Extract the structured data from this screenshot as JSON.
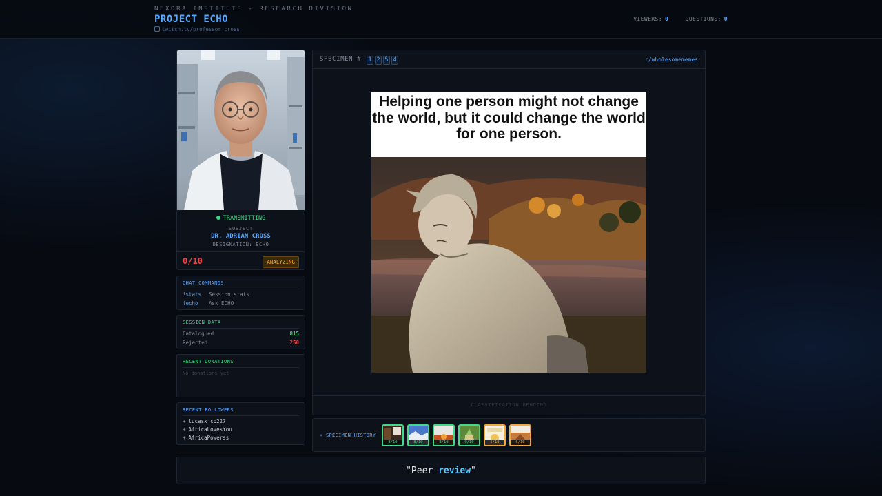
{
  "header": {
    "org": "NEXORA INSTITUTE - RESEARCH DIVISION",
    "project": "PROJECT ECHO",
    "channel": "twitch.tv/professor_cross",
    "viewers_label": "VIEWERS:",
    "viewers_value": "0",
    "questions_label": "QUESTIONS:",
    "questions_value": "0"
  },
  "subject": {
    "status": "TRANSMITTING",
    "label": "SUBJECT",
    "name": "DR. ADRIAN CROSS",
    "designation": "DESIGNATION: ECHO",
    "score": "0/10",
    "badge": "ANALYZING"
  },
  "commands": {
    "title": "CHAT COMMANDS",
    "items": [
      {
        "cmd": "!stats",
        "desc": "Session stats"
      },
      {
        "cmd": "!echo",
        "desc": "Ask ECHO"
      }
    ]
  },
  "session": {
    "title": "SESSION DATA",
    "catalogued_label": "Catalogued",
    "catalogued_value": "815",
    "rejected_label": "Rejected",
    "rejected_value": "250"
  },
  "donations": {
    "title": "RECENT DONATIONS",
    "empty": "No donations yet"
  },
  "followers": {
    "title": "RECENT FOLLOWERS",
    "items": [
      "lucasx_cb227",
      "AfricaLovesYou",
      "AfricaPowerss"
    ]
  },
  "specimen": {
    "label": "SPECIMEN #",
    "digits": [
      "1",
      "2",
      "5",
      "4"
    ],
    "source": "r/wholesomememes",
    "caption": "Helping one person might not change the world, but it could change the world for one person.",
    "classification": "CLASSIFICATION PENDING"
  },
  "history": {
    "label": "« SPECIMEN HISTORY",
    "items": [
      {
        "score": "8/10",
        "tone": "green"
      },
      {
        "score": "8/10",
        "tone": "green"
      },
      {
        "score": "8/10",
        "tone": "green"
      },
      {
        "score": "9/10",
        "tone": "green"
      },
      {
        "score": "5/10",
        "tone": "amber"
      },
      {
        "score": "6/10",
        "tone": "amber"
      }
    ]
  },
  "quote": {
    "open": "\"Peer ",
    "highlight": "review",
    "close": "\""
  },
  "colors": {
    "accent": "#5aa8ff",
    "green": "#3ddc84",
    "amber": "#f2a93b",
    "red": "#ef4444"
  }
}
